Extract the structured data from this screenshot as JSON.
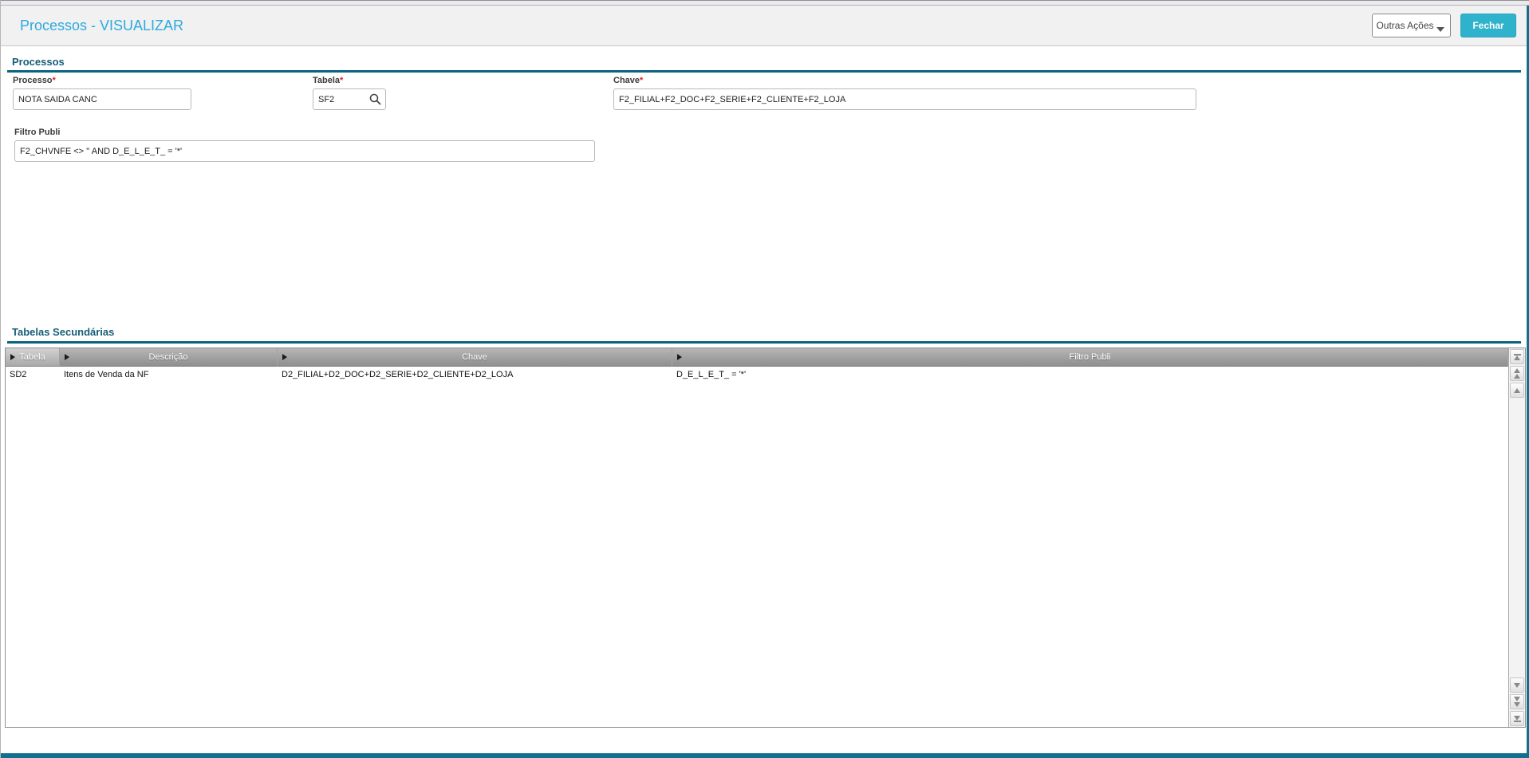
{
  "header": {
    "title": "Processos - VISUALIZAR",
    "other_actions_label": "Outras Ações",
    "close_label": "Fechar"
  },
  "form": {
    "section_title": "Processos",
    "fields": {
      "processo": {
        "label": "Processo",
        "required_mark": "*",
        "value": "NOTA SAIDA CANC"
      },
      "tabela": {
        "label": "Tabela",
        "required_mark": "*",
        "value": "SF2"
      },
      "chave": {
        "label": "Chave",
        "required_mark": "*",
        "value": "F2_FILIAL+F2_DOC+F2_SERIE+F2_CLIENTE+F2_LOJA"
      },
      "filtro": {
        "label": "Filtro Publi",
        "value": "F2_CHVNFE <> '' AND D_E_L_E_T_ = '*'"
      }
    }
  },
  "grid": {
    "section_title": "Tabelas Secundárias",
    "columns": [
      "Tabela",
      "Descrição",
      "Chave",
      "Filtro Publi"
    ],
    "rows": [
      [
        "SD2",
        "Itens de Venda da NF",
        "D2_FILIAL+D2_DOC+D2_SERIE+D2_CLIENTE+D2_LOJA",
        "D_E_L_E_T_ = '*'"
      ]
    ]
  },
  "colors": {
    "title_accent": "#2caade",
    "close_button": "#2fb2cb",
    "section_rule": "#0a647f",
    "page_frame": "#10708e"
  }
}
